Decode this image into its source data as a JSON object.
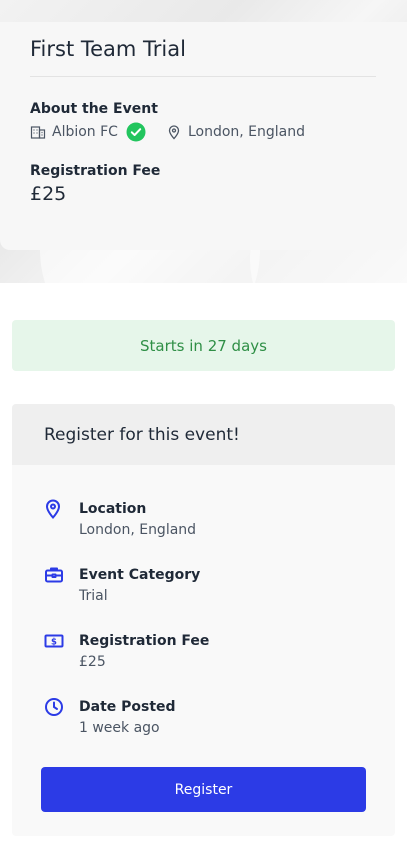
{
  "event": {
    "title": "First Team Trial",
    "about_label": "About the Event",
    "organization": "Albion FC",
    "location": "London, England",
    "fee_label": "Registration Fee",
    "fee_value": "£25"
  },
  "countdown": {
    "text": "Starts in 27 days"
  },
  "register": {
    "header": "Register for this event!",
    "details": [
      {
        "label": "Location",
        "value": "London, England",
        "icon": "location-pin-icon"
      },
      {
        "label": "Event Category",
        "value": "Trial",
        "icon": "briefcase-icon"
      },
      {
        "label": "Registration Fee",
        "value": "£25",
        "icon": "dollar-bill-icon"
      },
      {
        "label": "Date Posted",
        "value": "1 week ago",
        "icon": "clock-icon"
      }
    ],
    "button_label": "Register"
  },
  "colors": {
    "accent": "#2c3be6",
    "success_text": "#2f8f46",
    "success_bg": "#e6f6ea",
    "verified": "#22c55e"
  }
}
